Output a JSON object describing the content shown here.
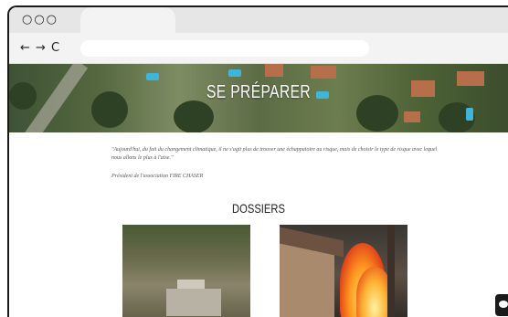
{
  "browser": {
    "window_dots": "○○○",
    "nav_icons": "← → C",
    "address": ""
  },
  "hero": {
    "title": "SE PRÉPARER"
  },
  "quote": {
    "text": "\"Aujourd'hui, du fait du changement climatique, il ne s'agit plus de trouver une échappatoire au risque, mais de choisir le type de risque avec lequel nous allons le plus à l'aise.\"",
    "author": "Président de l'association FIRE CHASER"
  },
  "dossiers": {
    "title": "DOSSIERS",
    "cards": [
      {
        "image": "village-ruins-photo"
      },
      {
        "image": "house-fire-photo"
      }
    ]
  },
  "colors": {
    "hero_green": "#55683f",
    "fire_orange": "#ff9a1f"
  }
}
